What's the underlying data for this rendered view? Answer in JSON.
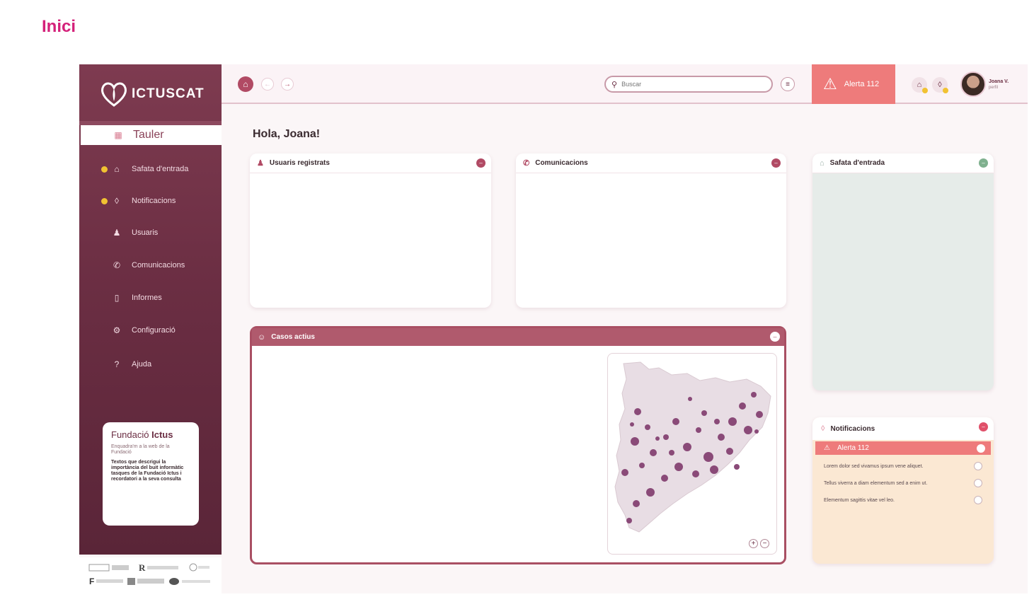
{
  "page": {
    "title": "Inici"
  },
  "logo": {
    "text": "ICTUSCAT"
  },
  "sidebar": {
    "items": [
      {
        "label": "Tauler",
        "icon": "grid-icon",
        "active": true
      },
      {
        "label": "Safata d'entrada",
        "icon": "inbox-icon",
        "badge": true
      },
      {
        "label": "Notificacions",
        "icon": "bell-icon",
        "badge": true
      },
      {
        "label": "Usuaris",
        "icon": "user-icon"
      },
      {
        "label": "Comunicacions",
        "icon": "megaphone-icon"
      },
      {
        "label": "Informes",
        "icon": "document-icon"
      },
      {
        "label": "Configuració",
        "icon": "gear-icon"
      },
      {
        "label": "Ajuda",
        "icon": "help-icon"
      }
    ],
    "promo": {
      "title_light": "Fundació",
      "title_bold": "Ictus",
      "subtitle": "Enquadra'm a la web de la Fundació",
      "body": "Textos que descrigui la importància del buit informàtic tasques de la Fundació Ictus i recordatori a la seva consulta"
    }
  },
  "topbar": {
    "search_placeholder": "Buscar",
    "alert_label": "Alerta 112",
    "user_name": "Joana V.",
    "user_role": "perfil"
  },
  "main": {
    "greeting": "Hola, Joana!",
    "cards": {
      "usuaris": "Usuaris registrats",
      "comunicacions": "Comunicacions",
      "safata": "Safata d'entrada",
      "casos": "Casos actius",
      "notificacions": "Notificacions"
    },
    "notifications": {
      "alert": "Alerta 112",
      "items": [
        "Lorem dolor sed vivamus ipsum vene aliquet.",
        "Tellus viverra a diam elementum sed a enim ut.",
        "Elementum sagittis vitae vel leo."
      ]
    }
  },
  "colors": {
    "brand": "#6b2e43",
    "accent_pink": "#d4217a",
    "alert": "#ee7b7b",
    "safata_bg": "#e6ece9",
    "notif_bg": "#fbe8d3"
  }
}
